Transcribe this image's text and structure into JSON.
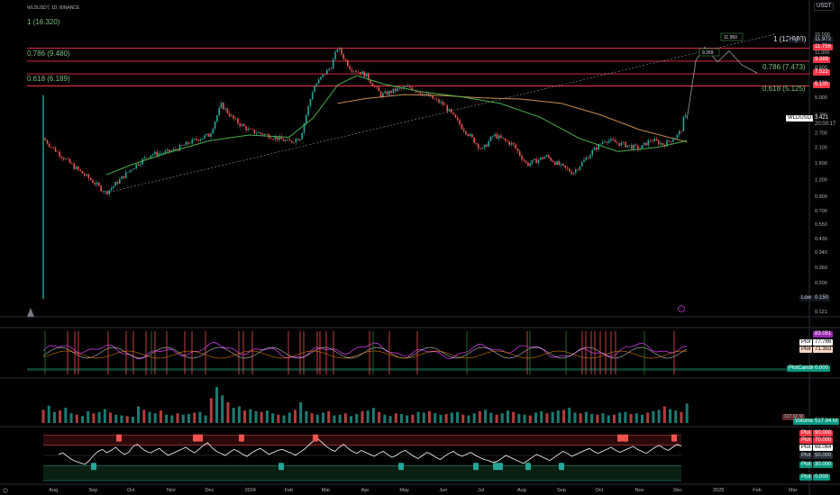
{
  "header": {
    "symbol_line": "WLDUSDT, 1D, BINANCE",
    "currency": "USDT",
    "fib_top": "1 (16.320)"
  },
  "colors": {
    "background": "#000000",
    "up": "#26a69a",
    "down": "#ef5350",
    "ema_fast": "#4caf50",
    "ema_slow": "#c98b52",
    "fib_line": "#f23645",
    "fib_text": "#7fbf7f",
    "rsi_line": "#ffffff",
    "osc_pink": "#e040fb",
    "osc_orange": "#ff9800"
  },
  "fib_labels": {
    "left_786": "0.786 (9.480)",
    "left_618": "0.618 (6.189)",
    "right_1": "1 (12.008)",
    "right_786": "0.786 (7.473)",
    "right_618": "0.618 (5.125)"
  },
  "annotations": {
    "peak_1": "11.950",
    "peak_2": "9.269"
  },
  "price_tags": {
    "high_label": "High",
    "high_value": "11.972",
    "tag_11756": "11.756",
    "tag_9389": "9.389",
    "tag_7522": "7.522",
    "tag_6100": "6.100",
    "ticker": "WLDUSDT",
    "last_price": "3.421",
    "countdown": "20:00:17",
    "low_label": "Low",
    "low_value": "0.150"
  },
  "indicator_tags": {
    "osc_1": "83.051",
    "osc_2_label": "Plot",
    "osc_2": "77.786",
    "osc_3_label": "Plot",
    "osc_3": "71.353",
    "osc_candle_label": "PlotCandle",
    "osc_candle": "0.000",
    "vol_label": "Volume",
    "vol_value": "517.94 M",
    "vol_mini": "317.92 M",
    "rsi_90_label": "Plot",
    "rsi_90": "90.000",
    "rsi_70_label": "Plot",
    "rsi_70": "70.000",
    "rsi_val_label": "Plot",
    "rsi_val": "68.064",
    "rsi_50_label": "Plot",
    "rsi_50": "50.000",
    "rsi_30_label": "Plot",
    "rsi_30": "30.000",
    "rsi_0_label": "Plot",
    "rsi_0": "0.000"
  },
  "chart_data": {
    "type": "candlestick",
    "scale": "log",
    "y_ticks": [
      "15.000",
      "11.000",
      "8.500",
      "6.500",
      "5.000",
      "3.700",
      "2.700",
      "2.100",
      "1.600",
      "1.200",
      "0.900",
      "0.700",
      "0.550",
      "0.430",
      "0.340",
      "0.260",
      "0.200",
      "0.121"
    ],
    "x_ticks": [
      "Aug",
      "Sep",
      "Oct",
      "Nov",
      "Dec",
      "2024",
      "Feb",
      "Mar",
      "Apr",
      "May",
      "Jun",
      "Jul",
      "Aug",
      "Sep",
      "Oct",
      "Nov",
      "Dec",
      "2025",
      "Feb",
      "Mar"
    ],
    "price_series": {
      "dates": [
        "2023-07-24",
        "2023-08-01",
        "2023-08-15",
        "2023-09-01",
        "2023-09-11",
        "2023-10-01",
        "2023-10-15",
        "2023-11-01",
        "2023-11-20",
        "2023-12-01",
        "2023-12-10",
        "2023-12-20",
        "2024-01-01",
        "2024-01-15",
        "2024-02-01",
        "2024-02-10",
        "2024-02-20",
        "2024-02-27",
        "2024-03-05",
        "2024-03-10",
        "2024-03-20",
        "2024-04-01",
        "2024-04-13",
        "2024-04-25",
        "2024-05-05",
        "2024-05-20",
        "2024-06-01",
        "2024-06-15",
        "2024-07-01",
        "2024-07-10",
        "2024-07-25",
        "2024-08-05",
        "2024-08-20",
        "2024-09-01",
        "2024-09-10",
        "2024-09-25",
        "2024-10-05",
        "2024-10-20",
        "2024-11-01",
        "2024-11-10",
        "2024-11-20",
        "2024-12-01",
        "2024-12-04",
        "2024-12-06",
        "2024-12-08"
      ],
      "close": [
        2.45,
        2.05,
        1.55,
        1.15,
        0.95,
        1.45,
        1.85,
        1.95,
        2.4,
        2.6,
        4.4,
        3.4,
        2.8,
        2.6,
        2.3,
        2.5,
        5.9,
        7.2,
        8.6,
        11.9,
        8.3,
        7.4,
        5.2,
        5.7,
        6.0,
        5.1,
        4.4,
        3.0,
        2.0,
        2.6,
        2.2,
        1.55,
        1.8,
        1.5,
        1.35,
        1.95,
        2.4,
        2.2,
        2.05,
        2.4,
        2.2,
        2.6,
        2.9,
        3.7,
        3.421
      ]
    },
    "projection": {
      "dates": [
        "2024-12-08",
        "2024-12-15",
        "2024-12-22",
        "2025-01-01",
        "2025-01-10",
        "2025-01-20",
        "2025-02-01"
      ],
      "values": [
        3.421,
        9.5,
        11.95,
        9.269,
        11.2,
        8.8,
        7.6
      ]
    },
    "ema_fast_series": {
      "dates": [
        "2023-09-11",
        "2023-10-01",
        "2023-11-01",
        "2023-12-01",
        "2024-01-01",
        "2024-02-01",
        "2024-02-20",
        "2024-03-10",
        "2024-03-25",
        "2024-04-15",
        "2024-05-15",
        "2024-06-15",
        "2024-07-15",
        "2024-08-15",
        "2024-09-15",
        "2024-10-15",
        "2024-11-15",
        "2024-12-08"
      ],
      "values": [
        1.3,
        1.55,
        1.95,
        2.35,
        2.6,
        2.5,
        3.5,
        6.2,
        7.3,
        6.3,
        5.5,
        5.05,
        4.5,
        3.55,
        2.45,
        1.95,
        2.1,
        2.35
      ]
    },
    "ema_slow_series": {
      "dates": [
        "2024-03-10",
        "2024-04-01",
        "2024-05-01",
        "2024-06-01",
        "2024-07-01",
        "2024-08-01",
        "2024-09-01",
        "2024-10-01",
        "2024-11-01",
        "2024-12-08"
      ],
      "values": [
        4.5,
        4.9,
        5.25,
        5.15,
        4.95,
        4.85,
        4.5,
        3.7,
        2.85,
        2.3
      ]
    },
    "trendline": {
      "dates": [
        "2023-09-11",
        "2025-02-15"
      ],
      "values": [
        0.95,
        15.0
      ]
    },
    "fib_levels": [
      11.756,
      9.389,
      7.522,
      6.1
    ],
    "volume": [
      95,
      125,
      80,
      90,
      110,
      70,
      60,
      50,
      85,
      70,
      80,
      100,
      75,
      60,
      55,
      50,
      45,
      120,
      95,
      80,
      70,
      90,
      60,
      55,
      70,
      60,
      65,
      75,
      80,
      55,
      180,
      260,
      200,
      150,
      110,
      120,
      90,
      100,
      85,
      80,
      90,
      70,
      60,
      55,
      75,
      95,
      150,
      85,
      70,
      60,
      75,
      85,
      55,
      60,
      70,
      50,
      65,
      85,
      90,
      110,
      80,
      60,
      50,
      70,
      65,
      55,
      60,
      80,
      75,
      85,
      70,
      60,
      65,
      75,
      80,
      60,
      55,
      70,
      85,
      95,
      75,
      60,
      70,
      90,
      80,
      65,
      60,
      55,
      75,
      85,
      70,
      80,
      90,
      95,
      110,
      75,
      70,
      80,
      65,
      60,
      70,
      55,
      60,
      75,
      80,
      65,
      70,
      60,
      75,
      85,
      95,
      120,
      100,
      90,
      80,
      140
    ],
    "rsi": {
      "values": [
        52,
        55,
        48,
        42,
        38,
        35,
        32,
        40,
        50,
        58,
        62,
        55,
        60,
        66,
        58,
        52,
        56,
        68,
        72,
        64,
        58,
        55,
        60,
        64,
        56,
        50,
        54,
        58,
        62,
        66,
        60,
        55,
        62,
        70,
        75,
        65,
        58,
        54,
        50,
        56,
        62,
        58,
        52,
        48,
        55,
        60,
        64,
        58,
        52,
        56,
        60,
        62,
        58,
        55,
        50,
        56,
        62,
        70,
        78,
        84,
        76,
        68,
        62,
        58,
        66,
        72,
        64,
        58,
        54,
        60,
        56,
        52,
        48,
        54,
        58,
        52,
        46,
        50,
        56,
        60,
        54,
        48,
        44,
        50,
        56,
        52,
        46,
        42,
        48,
        54,
        58,
        52,
        48,
        52,
        56,
        50,
        46,
        42,
        40,
        36,
        38,
        44,
        50,
        46,
        42,
        38,
        34,
        40,
        46,
        52,
        48,
        44,
        40,
        46,
        52,
        58,
        54,
        48,
        52,
        56,
        60,
        64,
        58,
        54,
        58,
        62,
        66,
        60,
        56,
        60,
        64,
        68,
        62,
        58,
        54,
        60,
        66,
        70,
        64,
        60,
        66,
        72,
        68
      ],
      "levels": [
        90,
        70,
        50,
        30,
        0
      ]
    }
  }
}
